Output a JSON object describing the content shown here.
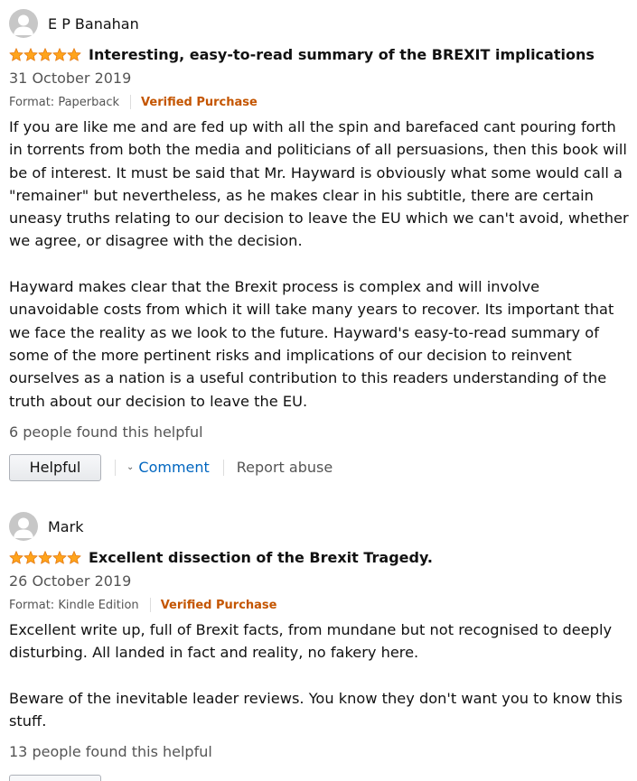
{
  "reviews": [
    {
      "author": "E P Banahan",
      "rating": 5,
      "title": "Interesting, easy-to-read summary of the BREXIT implications",
      "date": "31 October 2019",
      "format": "Format: Paperback",
      "verified": "Verified Purchase",
      "paragraphs": [
        "If you are like me and are fed up with all the spin and barefaced cant pouring forth in torrents from both the media and politicians of all persuasions, then this book will be of interest. It must be said that Mr. Hayward is obviously what some would call a \"remainer\" but nevertheless, as he makes clear in his subtitle, there are certain uneasy truths relating to our decision to leave the EU which we can't avoid, whether we agree, or disagree with the decision.",
        "Hayward makes clear that the Brexit process is complex and will involve unavoidable costs from which it will take many years to recover. Its important that we face the reality as we look to the future. Hayward's easy-to-read summary of some of the more pertinent risks and implications of our decision to reinvent ourselves as a nation is a useful contribution to this readers understanding of the truth about our decision to leave the EU."
      ],
      "helpful_count": "6 people found this helpful",
      "helpful_label": "Helpful",
      "comment_label": "Comment",
      "report_label": "Report abuse"
    },
    {
      "author": "Mark",
      "rating": 5,
      "title": "Excellent dissection of the Brexit Tragedy.",
      "date": "26 October 2019",
      "format": "Format: Kindle Edition",
      "verified": "Verified Purchase",
      "paragraphs": [
        "Excellent write up, full of Brexit facts, from mundane but not recognised to deeply disturbing. All landed in fact and reality, no fakery here.",
        "Beware of the inevitable leader reviews. You know they don't want you to know this stuff."
      ],
      "helpful_count": "13 people found this helpful"
    }
  ],
  "colors": {
    "star": "#ffa41c",
    "verified": "#c45500",
    "link": "#0066c0"
  },
  "icons": {
    "avatar": "default-user-avatar-icon",
    "star": "star-icon",
    "chevron": "chevron-down-icon"
  }
}
